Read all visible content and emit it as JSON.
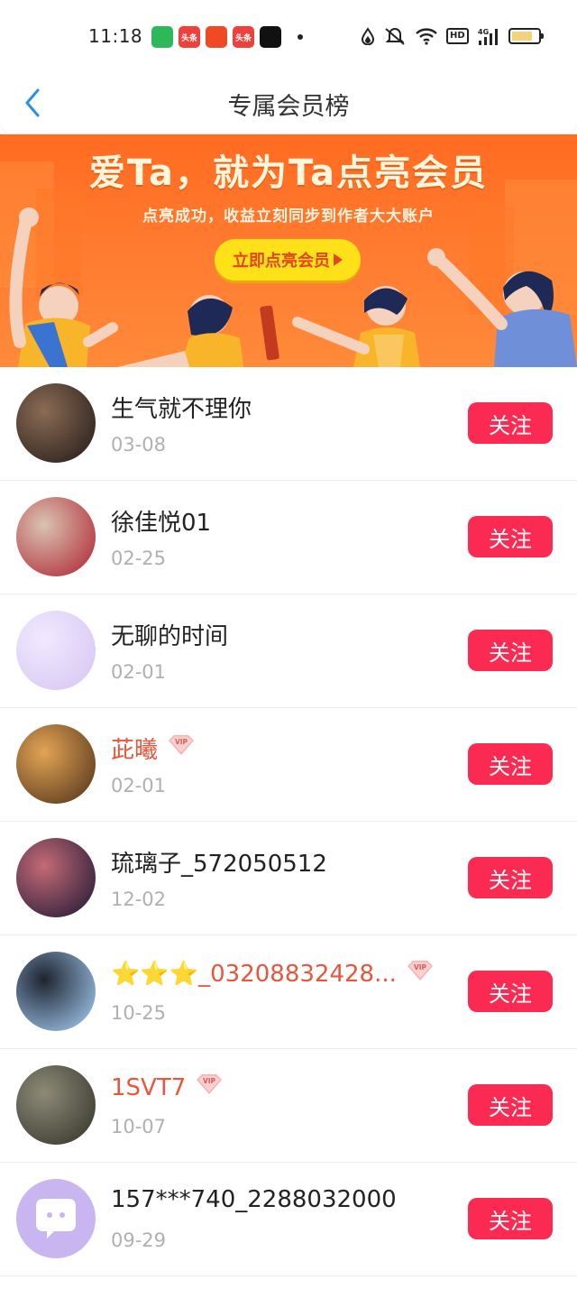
{
  "status_bar": {
    "time": "11:18",
    "notification_icons": [
      {
        "name": "app-green-icon",
        "color": "#2db85a",
        "text": ""
      },
      {
        "name": "toutiao-icon",
        "color": "#f0403c",
        "text": "头条"
      },
      {
        "name": "video-play-icon",
        "color": "#f04a24",
        "text": ""
      },
      {
        "name": "toutiao-lite-icon",
        "color": "#f0403c",
        "text": "头条"
      },
      {
        "name": "tiktok-icon",
        "color": "#111111",
        "text": ""
      }
    ]
  },
  "header": {
    "title": "专属会员榜"
  },
  "banner": {
    "title": "爱Ta，就为Ta点亮会员",
    "subtitle": "点亮成功，收益立刻同步到作者大大账户",
    "button_label": "立即点亮会员"
  },
  "members": [
    {
      "name": "生气就不理你",
      "date": "03-08",
      "vip": false,
      "avatar": [
        "#2b211c",
        "#8a6b55"
      ]
    },
    {
      "name": "徐佳悦01",
      "date": "02-25",
      "vip": false,
      "avatar": [
        "#b22f3a",
        "#d9c3b2"
      ]
    },
    {
      "name": "无聊的时间",
      "date": "02-01",
      "vip": false,
      "avatar": [
        "#d7c8f3",
        "#f2e9ff"
      ]
    },
    {
      "name": "茈曦",
      "date": "02-01",
      "vip": true,
      "avatar": [
        "#5a3a1e",
        "#e2a454"
      ]
    },
    {
      "name": "琉璃子_572050512",
      "date": "12-02",
      "vip": false,
      "avatar": [
        "#2a1d3a",
        "#c46a76"
      ]
    },
    {
      "name": "⭐⭐⭐_03208832428...",
      "date": "10-25",
      "vip": true,
      "avatar": [
        "#9cc3e8",
        "#1e2430"
      ]
    },
    {
      "name": "1SVT7",
      "date": "10-07",
      "vip": true,
      "avatar": [
        "#3a3a30",
        "#8d8a76"
      ]
    },
    {
      "name": "157***740_2288032000",
      "date": "09-29",
      "vip": false,
      "avatar": [
        "#c9b5ef",
        "#c9b5ef"
      ]
    }
  ],
  "follow_label": "关注",
  "colors": {
    "accent_red": "#fb2a52",
    "vip_name": "#e8563e",
    "back_arrow": "#2a90e0",
    "banner_orange": "#ff6b21",
    "banner_button": "#ffe11a"
  }
}
